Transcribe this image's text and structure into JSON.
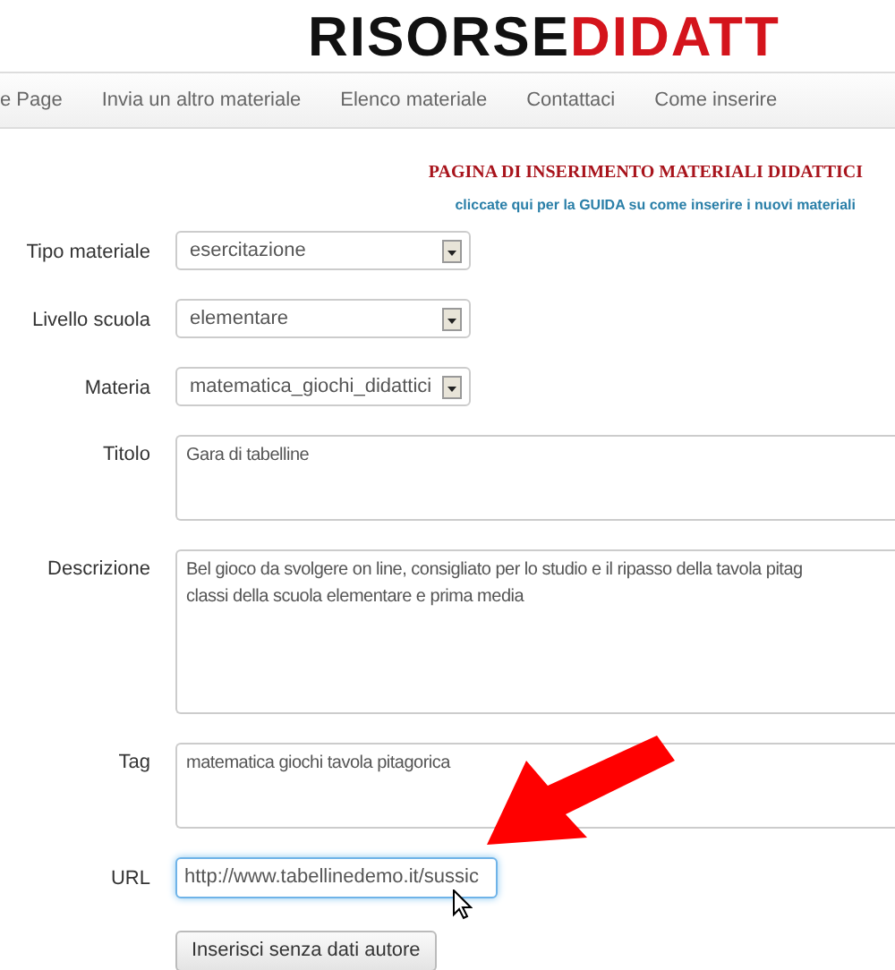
{
  "logo": {
    "dark": "RISORSE",
    "accent": "DIDATT"
  },
  "nav": [
    {
      "label": "e Page"
    },
    {
      "label": "Invia un altro materiale"
    },
    {
      "label": "Elenco materiale"
    },
    {
      "label": "Contattaci"
    },
    {
      "label": "Come inserire"
    }
  ],
  "heading": "PAGINA DI INSERIMENTO MATERIALI DIDATTICI",
  "guide_link": "cliccate qui per la GUIDA su come inserire i nuovi materiali",
  "fields": [
    {
      "kind": "select",
      "label": "Tipo materiale",
      "value": "esercitazione"
    },
    {
      "kind": "select",
      "label": "Livello scuola",
      "value": "elementare"
    },
    {
      "kind": "select",
      "label": "Materia",
      "value": "matematica_giochi_didattici"
    },
    {
      "kind": "short_text",
      "label": "Titolo",
      "lines": [
        "Gara di tabelline"
      ]
    },
    {
      "kind": "long_text",
      "label": "Descrizione",
      "lines": [
        "Bel gioco da svolgere on line, consigliato per lo studio e il ripasso della tavola pitag",
        "classi della scuola elementare e prima media"
      ]
    },
    {
      "kind": "short_text",
      "label": "Tag",
      "lines": [
        "matematica giochi tavola pitagorica"
      ]
    },
    {
      "kind": "input",
      "label": "URL",
      "value": "http://www.tabellinedemo.it/sussic",
      "focused": true
    }
  ],
  "submit": "Inserisci senza dati autore"
}
